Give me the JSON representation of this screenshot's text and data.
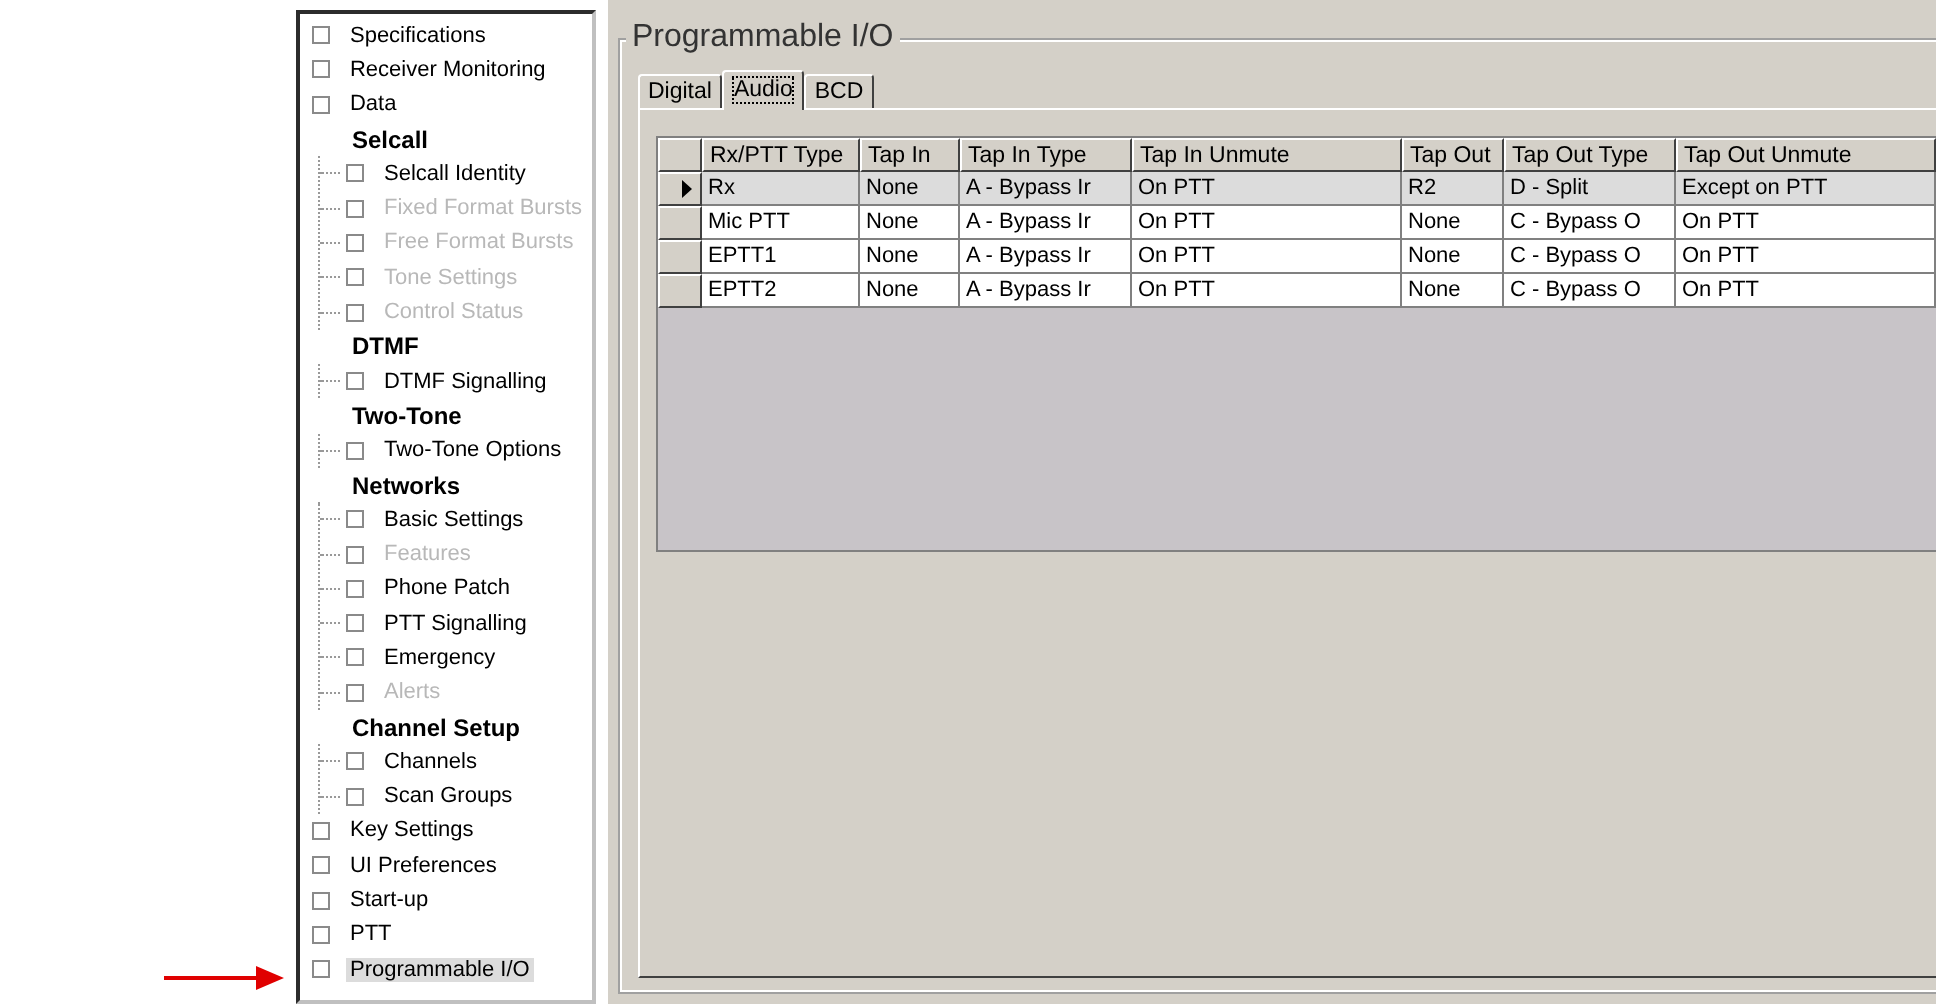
{
  "tree": [
    {
      "kind": "page",
      "label": "Specifications",
      "checked": false,
      "disabled": false,
      "selected": false
    },
    {
      "kind": "page",
      "label": "Receiver Monitoring",
      "checked": false,
      "disabled": false,
      "selected": false
    },
    {
      "kind": "page",
      "label": "Data",
      "checked": false,
      "disabled": false,
      "selected": false
    },
    {
      "kind": "group",
      "label": "Selcall",
      "children": [
        {
          "label": "Selcall Identity",
          "checked": false,
          "disabled": false,
          "selected": false
        },
        {
          "label": "Fixed Format Bursts",
          "checked": false,
          "disabled": true,
          "selected": false
        },
        {
          "label": "Free Format Bursts",
          "checked": false,
          "disabled": true,
          "selected": false
        },
        {
          "label": "Tone Settings",
          "checked": false,
          "disabled": true,
          "selected": false
        },
        {
          "label": "Control Status",
          "checked": false,
          "disabled": true,
          "selected": false
        }
      ]
    },
    {
      "kind": "group",
      "label": "DTMF",
      "children": [
        {
          "label": "DTMF Signalling",
          "checked": false,
          "disabled": false,
          "selected": false
        }
      ]
    },
    {
      "kind": "group",
      "label": "Two-Tone",
      "children": [
        {
          "label": "Two-Tone Options",
          "checked": false,
          "disabled": false,
          "selected": false
        }
      ]
    },
    {
      "kind": "group",
      "label": "Networks",
      "children": [
        {
          "label": "Basic Settings",
          "checked": false,
          "disabled": false,
          "selected": false
        },
        {
          "label": "Features",
          "checked": false,
          "disabled": true,
          "selected": false
        },
        {
          "label": "Phone Patch",
          "checked": false,
          "disabled": false,
          "selected": false
        },
        {
          "label": "PTT Signalling",
          "checked": false,
          "disabled": false,
          "selected": false
        },
        {
          "label": "Emergency",
          "checked": false,
          "disabled": false,
          "selected": false
        },
        {
          "label": "Alerts",
          "checked": false,
          "disabled": true,
          "selected": false
        }
      ]
    },
    {
      "kind": "group",
      "label": "Channel Setup",
      "children": [
        {
          "label": "Channels",
          "checked": false,
          "disabled": false,
          "selected": false
        },
        {
          "label": "Scan Groups",
          "checked": false,
          "disabled": false,
          "selected": false
        }
      ]
    },
    {
      "kind": "page",
      "label": "Key Settings",
      "checked": false,
      "disabled": false,
      "selected": false
    },
    {
      "kind": "page",
      "label": "UI Preferences",
      "checked": false,
      "disabled": false,
      "selected": false
    },
    {
      "kind": "page",
      "label": "Start-up",
      "checked": false,
      "disabled": false,
      "selected": false
    },
    {
      "kind": "page",
      "label": "PTT",
      "checked": false,
      "disabled": false,
      "selected": false
    },
    {
      "kind": "page",
      "label": "Programmable I/O",
      "checked": false,
      "disabled": false,
      "selected": true
    }
  ],
  "panel": {
    "title": "Programmable I/O",
    "tabs": [
      {
        "label": "Digital",
        "selected": false
      },
      {
        "label": "Audio",
        "selected": true
      },
      {
        "label": "BCD",
        "selected": false
      }
    ],
    "table": {
      "columns": [
        "Rx/PTT Type",
        "Tap In",
        "Tap In Type",
        "Tap In Unmute",
        "Tap Out",
        "Tap Out Type",
        "Tap Out Unmute"
      ],
      "rows": [
        {
          "selected": true,
          "cells": [
            "Rx",
            "None",
            "A - Bypass Ir",
            "On PTT",
            "R2",
            "D - Split",
            "Except on PTT"
          ]
        },
        {
          "selected": false,
          "cells": [
            "Mic PTT",
            "None",
            "A - Bypass Ir",
            "On PTT",
            "None",
            "C - Bypass O",
            "On PTT"
          ]
        },
        {
          "selected": false,
          "cells": [
            "EPTT1",
            "None",
            "A - Bypass Ir",
            "On PTT",
            "None",
            "C - Bypass O",
            "On PTT"
          ]
        },
        {
          "selected": false,
          "cells": [
            "EPTT2",
            "None",
            "A - Bypass Ir",
            "On PTT",
            "None",
            "C - Bypass O",
            "On PTT"
          ]
        }
      ]
    }
  }
}
